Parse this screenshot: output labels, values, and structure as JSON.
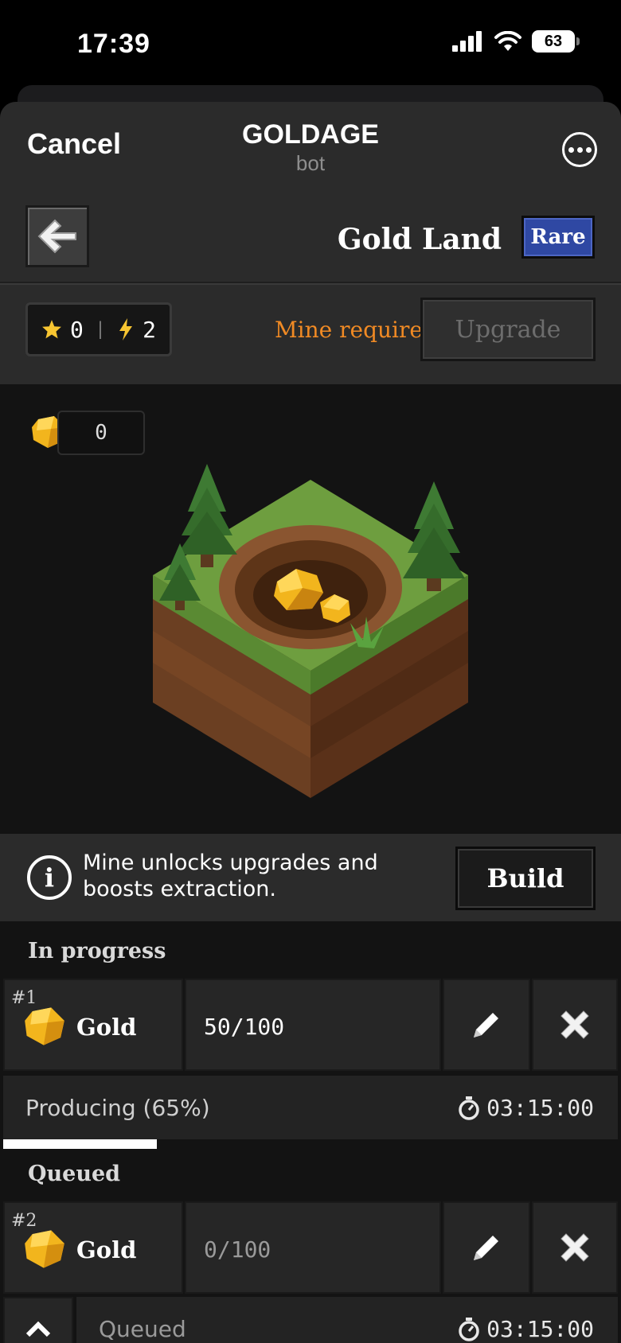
{
  "status": {
    "time": "17:39",
    "battery": "63"
  },
  "sheet": {
    "cancel": "Cancel",
    "title": "GOLDAGE",
    "subtitle": "bot"
  },
  "land": {
    "title": "Gold Land",
    "rarity": "Rare"
  },
  "stats": {
    "stars": "0",
    "energy": "2"
  },
  "upgrade": {
    "requirement": "Mine required",
    "label": "Upgrade"
  },
  "scene": {
    "gold_amount": "0"
  },
  "info": {
    "text": "Mine unlocks upgrades and boosts extraction.",
    "build_label": "Build"
  },
  "in_progress": {
    "heading": "In progress",
    "item": {
      "number": "#1",
      "resource": "Gold",
      "quantity": "50/100",
      "status": "Producing (65%)",
      "progress": 0.25,
      "timer": "03:15:00"
    }
  },
  "queued": {
    "heading": "Queued",
    "item": {
      "number": "#2",
      "resource": "Gold",
      "quantity": "0/100",
      "status": "Queued",
      "timer": "03:15:00"
    }
  },
  "colors": {
    "accent_orange": "#f08a24",
    "rare_blue": "#2f48a3",
    "gold": "#f2b51d"
  }
}
